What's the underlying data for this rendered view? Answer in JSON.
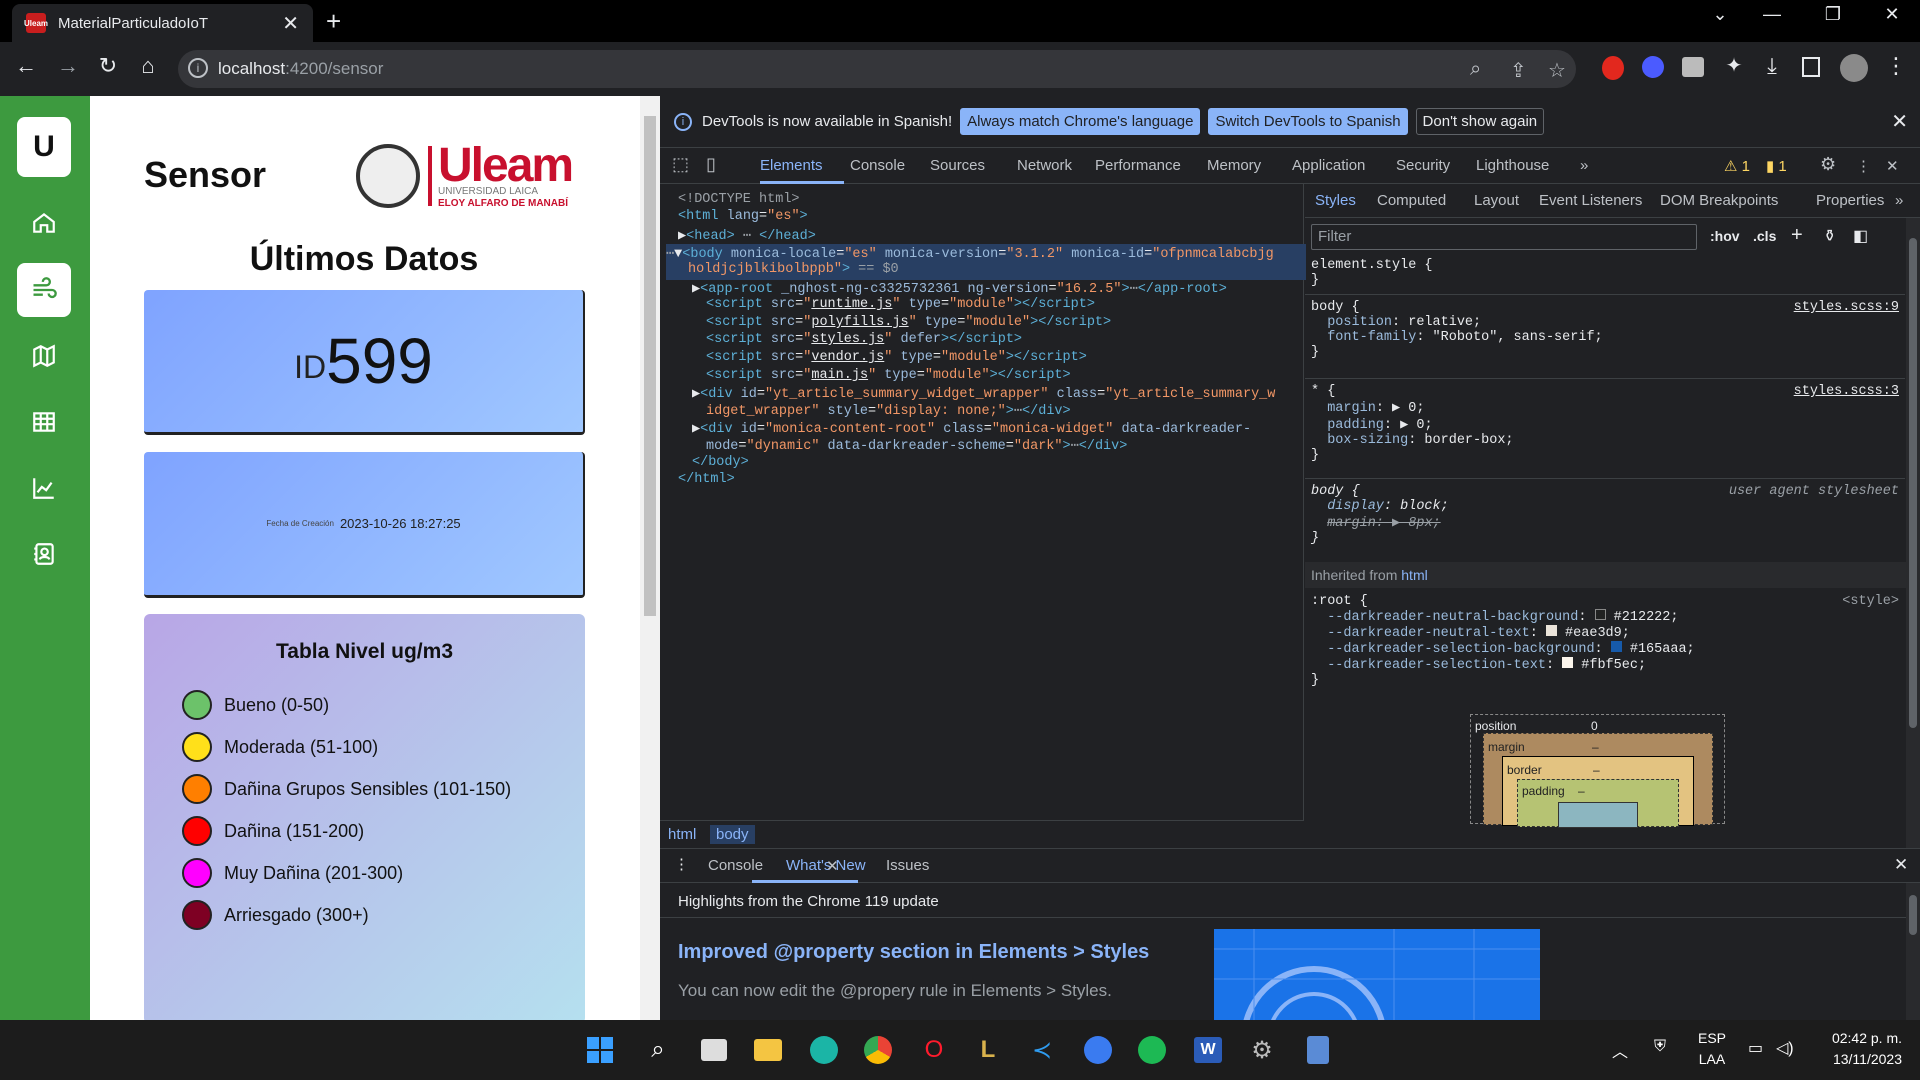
{
  "browser": {
    "tab_title": "MaterialParticuladoIoT",
    "url_host": "localhost",
    "url_path": ":4200/sensor",
    "colors": {
      "frame": "#000000",
      "toolbar": "#202124",
      "omnibox": "#35363a"
    }
  },
  "app": {
    "logo_letter": "U",
    "title": "Sensor",
    "brand_name": "Uleam",
    "brand_sub1": "UNIVERSIDAD LAICA",
    "brand_sub2": "ELOY ALFARO DE MANABÍ",
    "heading": "Últimos Datos",
    "id_label": "ID",
    "id_value": "599",
    "date_label": "Fecha de Creación",
    "date_value": "2023-10-26 18:27:25",
    "table_title": "Tabla Nivel ug/m3",
    "levels": [
      {
        "label": "Bueno (0-50)",
        "color": "#6cc26a"
      },
      {
        "label": "Moderada (51-100)",
        "color": "#ffe01a"
      },
      {
        "label": "Dañina Grupos Sensibles (101-150)",
        "color": "#ff7f00"
      },
      {
        "label": "Dañina (151-200)",
        "color": "#ff0000"
      },
      {
        "label": "Muy Dañina (201-300)",
        "color": "#ff00ff"
      },
      {
        "label": "Arriesgado (300+)",
        "color": "#7e0023"
      }
    ],
    "sidebar_icons": [
      "home-icon",
      "wind-icon",
      "map-icon",
      "table-icon",
      "chart-icon",
      "contact-icon"
    ],
    "colors": {
      "sidebar": "#3d9a3f",
      "brand": "#c8102e"
    }
  },
  "devtools": {
    "banner_text": "DevTools is now available in Spanish!",
    "banner_btn1": "Always match Chrome's language",
    "banner_btn2": "Switch DevTools to Spanish",
    "banner_btn3": "Don't show again",
    "tabs": [
      "Elements",
      "Console",
      "Sources",
      "Network",
      "Performance",
      "Memory",
      "Application",
      "Security",
      "Lighthouse"
    ],
    "warn_count": "1",
    "issue_count": "1",
    "crumb1": "html",
    "crumb2": "body",
    "style_tabs": [
      "Styles",
      "Computed",
      "Layout",
      "Event Listeners",
      "DOM Breakpoints",
      "Properties"
    ],
    "filter_placeholder": "Filter",
    "hov": ":hov",
    "cls": ".cls",
    "inherited_label": "Inherited from",
    "inherited_from": "html",
    "src1": "styles.scss:9",
    "src2": "styles.scss:3",
    "ua": "user agent stylesheet",
    "style_tag": "<style>",
    "bm_position": "position",
    "bm_position_val": "0",
    "bm_margin": "margin",
    "bm_border": "border",
    "bm_padding": "padding",
    "bm_dash": "–",
    "drawer_tabs": [
      "Console",
      "What's New",
      "Issues"
    ],
    "drawer_heading": "Highlights from the Chrome 119 update",
    "promo_title": "Improved @property section in Elements > Styles",
    "promo_text": "You can now edit the @propery rule in Elements > Styles."
  },
  "taskbar": {
    "lang1": "ESP",
    "lang2": "LAA",
    "time": "02:42 p. m.",
    "date": "13/11/2023"
  }
}
